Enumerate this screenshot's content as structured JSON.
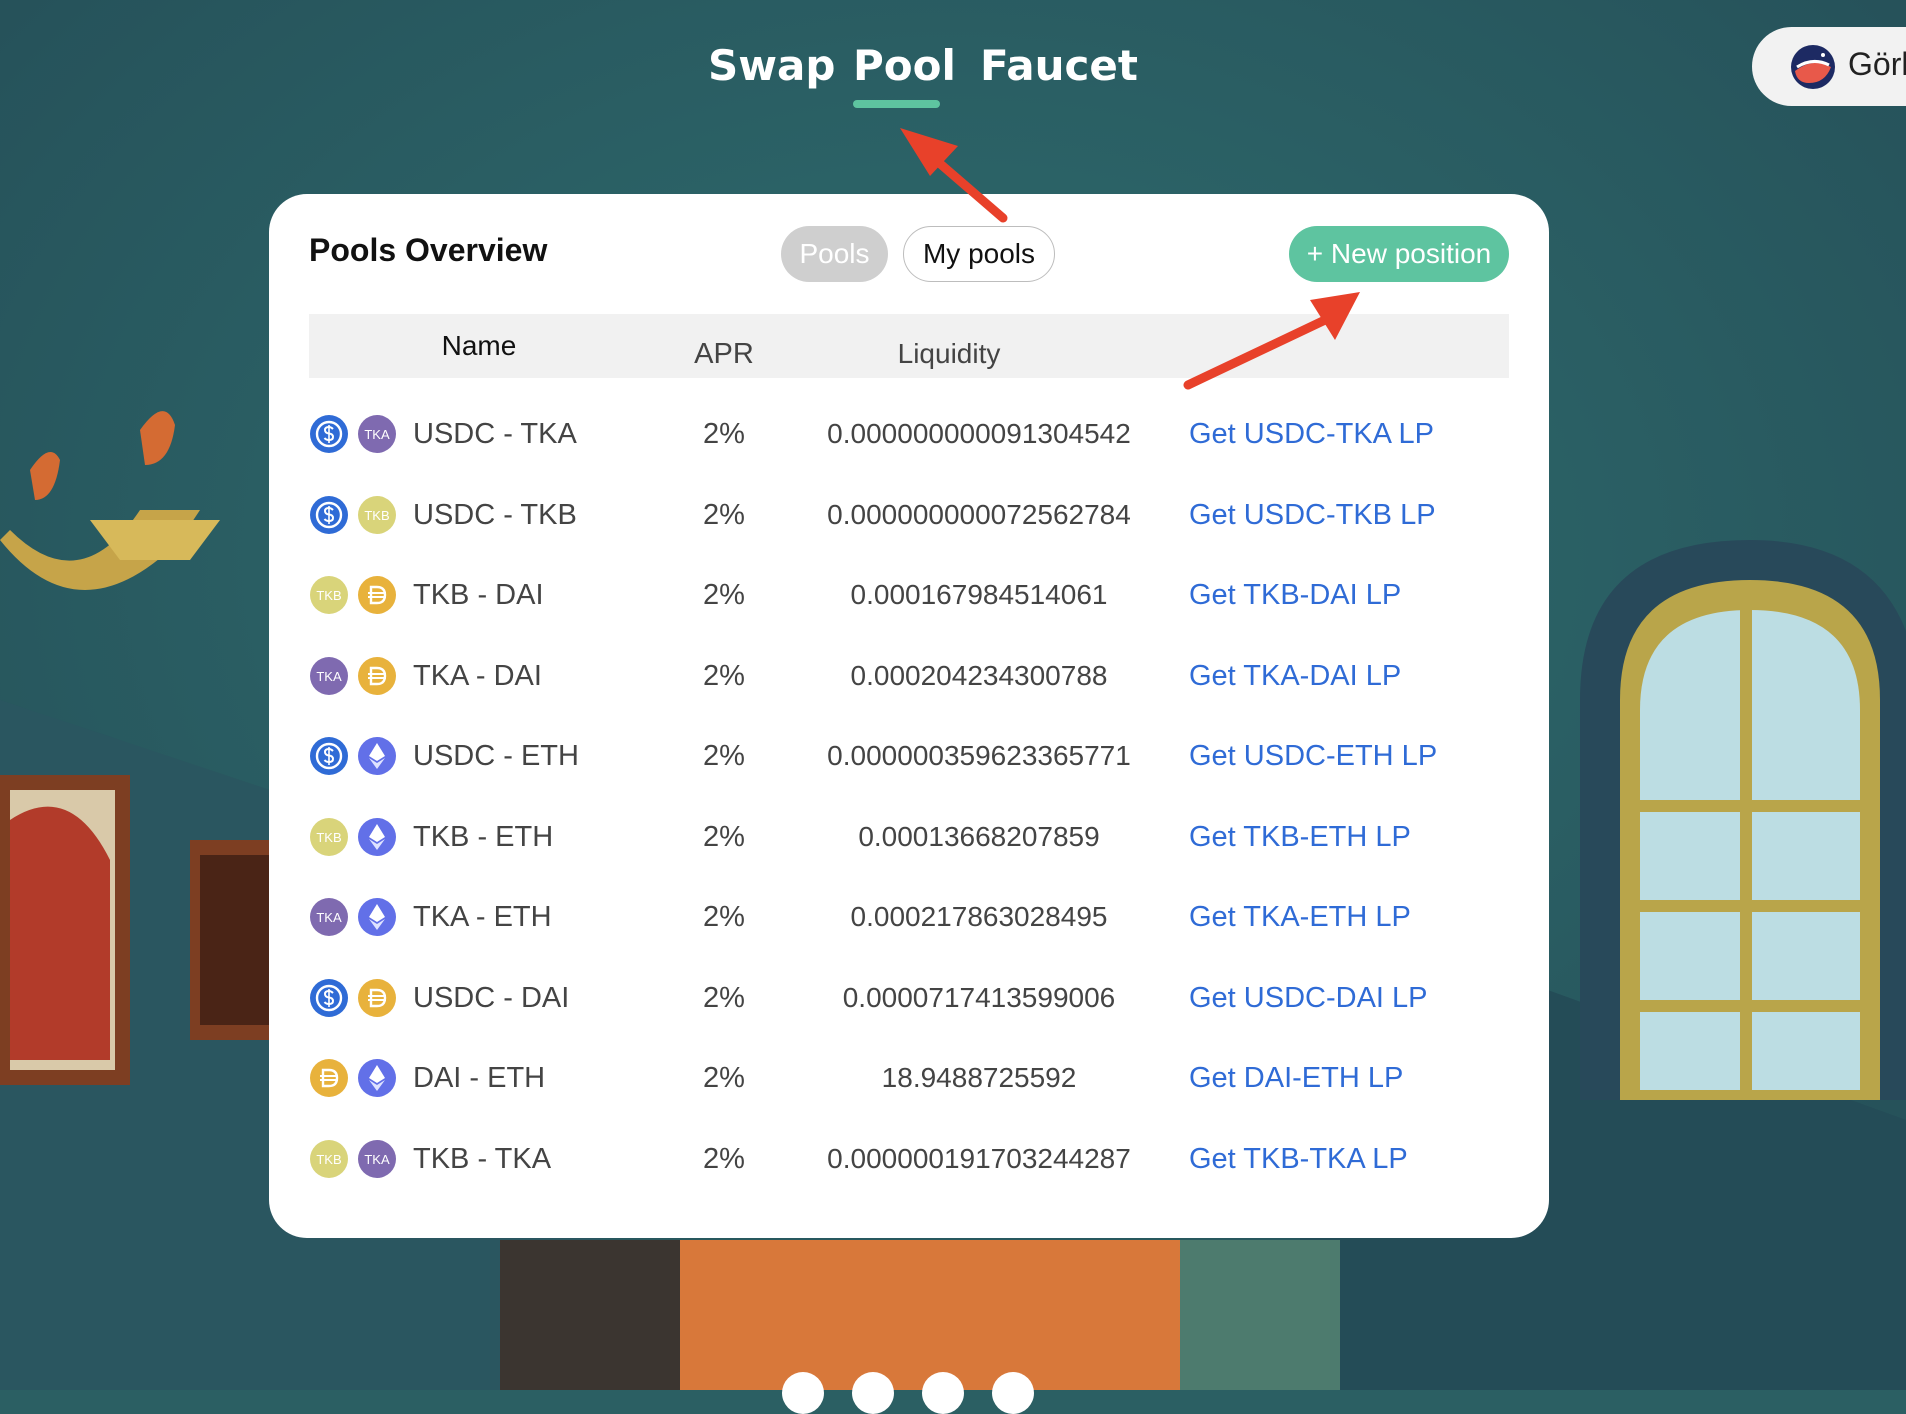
{
  "nav": {
    "tabs": [
      {
        "label": "Swap"
      },
      {
        "label": "Pool"
      },
      {
        "label": "Faucet"
      }
    ],
    "active_tab": "Pool"
  },
  "network": {
    "name": "Görl",
    "icon": "goerli-network-icon"
  },
  "card": {
    "title": "Pools Overview",
    "segments": {
      "pools_label": "Pools",
      "my_pools_label": "My pools",
      "active": "Pools"
    },
    "new_position_label": "+ New position",
    "columns": {
      "name": "Name",
      "apr": "APR",
      "liquidity": "Liquidity"
    },
    "rows": [
      {
        "pair": "USDC - TKA",
        "apr": "2%",
        "liquidity": "0.000000000091304542",
        "lp_label": "Get USDC-TKA LP",
        "tokens": [
          "USDC",
          "TKA"
        ]
      },
      {
        "pair": "USDC - TKB",
        "apr": "2%",
        "liquidity": "0.000000000072562784",
        "lp_label": "Get USDC-TKB LP",
        "tokens": [
          "USDC",
          "TKB"
        ]
      },
      {
        "pair": "TKB - DAI",
        "apr": "2%",
        "liquidity": "0.000167984514061",
        "lp_label": "Get TKB-DAI LP",
        "tokens": [
          "TKB",
          "DAI"
        ]
      },
      {
        "pair": "TKA - DAI",
        "apr": "2%",
        "liquidity": "0.000204234300788",
        "lp_label": "Get TKA-DAI LP",
        "tokens": [
          "TKA",
          "DAI"
        ]
      },
      {
        "pair": "USDC - ETH",
        "apr": "2%",
        "liquidity": "0.000000359623365771",
        "lp_label": "Get USDC-ETH LP",
        "tokens": [
          "USDC",
          "ETH"
        ]
      },
      {
        "pair": "TKB - ETH",
        "apr": "2%",
        "liquidity": "0.00013668207859",
        "lp_label": "Get TKB-ETH LP",
        "tokens": [
          "TKB",
          "ETH"
        ]
      },
      {
        "pair": "TKA - ETH",
        "apr": "2%",
        "liquidity": "0.000217863028495",
        "lp_label": "Get TKA-ETH LP",
        "tokens": [
          "TKA",
          "ETH"
        ]
      },
      {
        "pair": "USDC - DAI",
        "apr": "2%",
        "liquidity": "0.0000717413599006",
        "lp_label": "Get USDC-DAI LP",
        "tokens": [
          "USDC",
          "DAI"
        ]
      },
      {
        "pair": "DAI - ETH",
        "apr": "2%",
        "liquidity": "18.9488725592",
        "lp_label": "Get DAI-ETH LP",
        "tokens": [
          "DAI",
          "ETH"
        ]
      },
      {
        "pair": "TKB - TKA",
        "apr": "2%",
        "liquidity": "0.000000191703244287",
        "lp_label": "Get TKB-TKA LP",
        "tokens": [
          "TKB",
          "TKA"
        ]
      }
    ]
  },
  "tokens": {
    "USDC": {
      "icon": "usdc-icon",
      "color": "#2f6bd6",
      "text": ""
    },
    "TKA": {
      "icon": "tka-icon",
      "color": "#7f6ab0",
      "text": "TKA"
    },
    "TKB": {
      "icon": "tkb-icon",
      "color": "#d9d47a",
      "text": "TKB"
    },
    "DAI": {
      "icon": "dai-icon",
      "color": "#e8b23c",
      "text": ""
    },
    "ETH": {
      "icon": "eth-icon",
      "color": "#6270e8",
      "text": ""
    }
  },
  "colors": {
    "accent": "#5ec4a0",
    "link": "#2f6bd6",
    "annotation_arrow": "#e8412a"
  }
}
